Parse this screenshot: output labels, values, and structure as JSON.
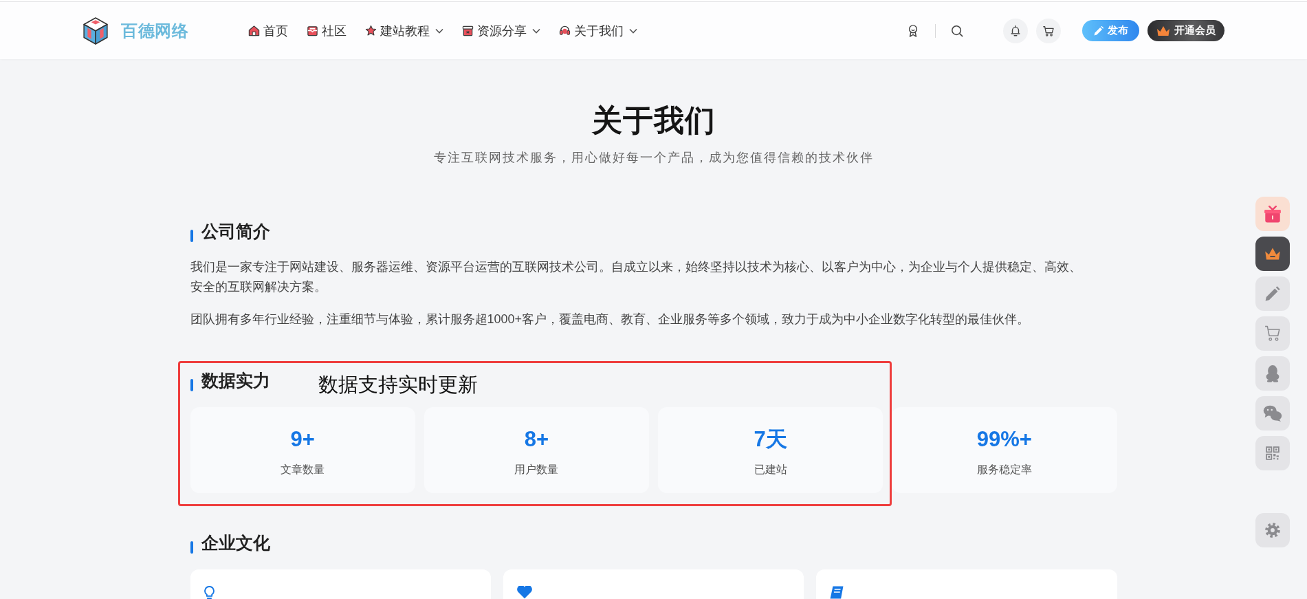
{
  "header": {
    "logo_text": "百德网络",
    "nav": [
      {
        "label": "首页",
        "dropdown": false
      },
      {
        "label": "社区",
        "dropdown": false
      },
      {
        "label": "建站教程",
        "dropdown": true
      },
      {
        "label": "资源分享",
        "dropdown": true
      },
      {
        "label": "关于我们",
        "dropdown": true
      }
    ],
    "publish_button": "发布",
    "vip_button": "开通会员"
  },
  "hero": {
    "title": "关于我们",
    "subtitle": "专注互联网技术服务，用心做好每一个产品，成为您值得信赖的技术伙伴"
  },
  "intro": {
    "heading": "公司简介",
    "paragraphs": [
      "我们是一家专注于网站建设、服务器运维、资源平台运营的互联网技术公司。自成立以来，始终坚持以技术为核心、以客户为中心，为企业与个人提供稳定、高效、安全的互联网解决方案。",
      "团队拥有多年行业经验，注重细节与体验，累计服务超1000+客户，覆盖电商、教育、企业服务等多个领域，致力于成为中小企业数字化转型的最佳伙伴。"
    ]
  },
  "stats": {
    "heading": "数据实力",
    "items": [
      {
        "value": "9+",
        "label": "文章数量"
      },
      {
        "value": "8+",
        "label": "用户数量"
      },
      {
        "value": "7天",
        "label": "已建站"
      },
      {
        "value": "99%+",
        "label": "服务稳定率"
      }
    ]
  },
  "annotation": {
    "text": "数据支持实时更新"
  },
  "culture": {
    "heading": "企业文化"
  }
}
